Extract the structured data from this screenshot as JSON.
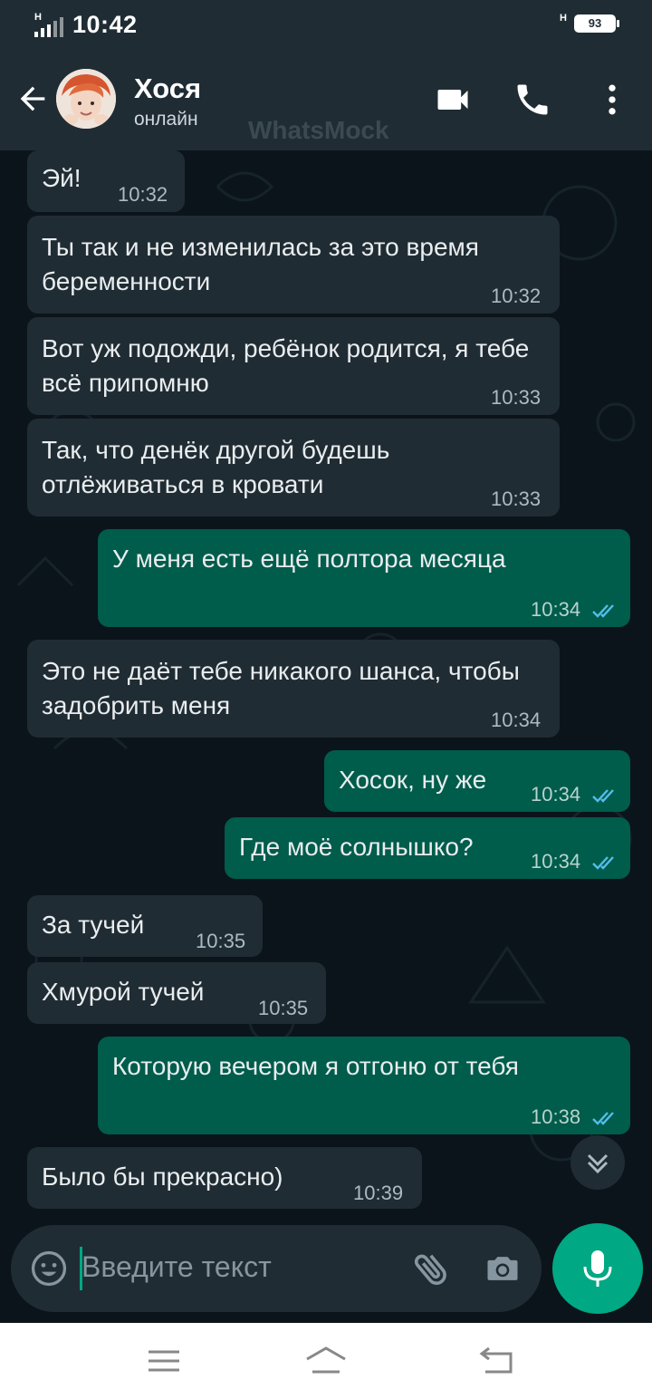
{
  "status_bar": {
    "time": "10:42",
    "network_left": "H",
    "network_right": "H",
    "battery": "93"
  },
  "header": {
    "contact_name": "Хося",
    "contact_status": "онлайн",
    "watermark": "WhatsMock"
  },
  "messages": [
    {
      "dir": "in",
      "text": "Эй!",
      "time": "10:32"
    },
    {
      "dir": "in",
      "text": "Ты так и не изменилась за это время беременности",
      "time": "10:32"
    },
    {
      "dir": "in",
      "text": "Вот уж подожди, ребёнок родится, я тебе всё припомню",
      "time": "10:33"
    },
    {
      "dir": "in",
      "text": "Так, что денёк другой будешь отлёживаться в кровати",
      "time": "10:33"
    },
    {
      "dir": "out",
      "text": "У меня есть ещё полтора месяца",
      "time": "10:34",
      "status": "read"
    },
    {
      "dir": "in",
      "text": "Это не даёт тебе никакого шанса, чтобы задобрить меня",
      "time": "10:34"
    },
    {
      "dir": "out",
      "text": "Хосок, ну же",
      "time": "10:34",
      "status": "read"
    },
    {
      "dir": "out",
      "text": "Где моё солнышко?",
      "time": "10:34",
      "status": "read"
    },
    {
      "dir": "in",
      "text": "За тучей",
      "time": "10:35"
    },
    {
      "dir": "in",
      "text": "Хмурой тучей",
      "time": "10:35"
    },
    {
      "dir": "out",
      "text": "Которую вечером я отгоню от тебя",
      "time": "10:38",
      "status": "read"
    },
    {
      "dir": "in",
      "text": "Было бы прекрасно)",
      "time": "10:39"
    }
  ],
  "composer": {
    "placeholder": "Введите текст"
  },
  "colors": {
    "header": "#1f2c34",
    "incoming": "#202c33",
    "outgoing": "#005c4b",
    "accent": "#00a884",
    "read_ticks": "#53bdeb"
  },
  "icons": [
    "back-arrow-icon",
    "video-call-icon",
    "phone-icon",
    "more-vert-icon",
    "chevron-down-icon",
    "emoji-icon",
    "attach-icon",
    "camera-icon",
    "mic-icon",
    "menu-icon",
    "home-icon",
    "back-nav-icon"
  ]
}
